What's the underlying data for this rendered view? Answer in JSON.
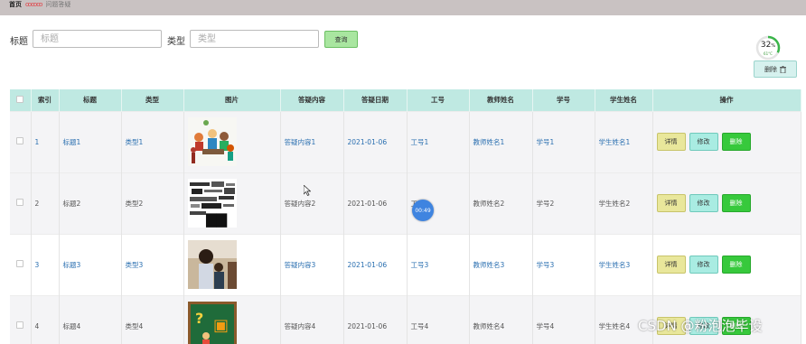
{
  "breadcrumb": {
    "home": "首页",
    "separator": "ꝏꝏꝏ",
    "current": "问题答疑"
  },
  "search": {
    "title_label": "标题",
    "title_placeholder": "标题",
    "type_label": "类型",
    "type_placeholder": "类型",
    "query_label": "查询"
  },
  "gauge": {
    "percent": "32",
    "unit": "%",
    "sub": "61°C",
    "fraction": 0.32
  },
  "batch_delete": {
    "label": "删除",
    "icon": "trash-icon"
  },
  "table": {
    "headers": [
      "索引",
      "标题",
      "类型",
      "图片",
      "答疑内容",
      "答疑日期",
      "工号",
      "教师姓名",
      "学号",
      "学生姓名",
      "操作"
    ],
    "rows": [
      {
        "index": "1",
        "title": "标题1",
        "type": "类型1",
        "content": "答疑内容1",
        "date": "2021-01-06",
        "staff_no": "工号1",
        "teacher": "教师姓名1",
        "student_no": "学号1",
        "student": "学生姓名1"
      },
      {
        "index": "2",
        "title": "标题2",
        "type": "类型2",
        "content": "答疑内容2",
        "date": "2021-01-06",
        "staff_no": "工号2",
        "teacher": "教师姓名2",
        "student_no": "学号2",
        "student": "学生姓名2"
      },
      {
        "index": "3",
        "title": "标题3",
        "type": "类型3",
        "content": "答疑内容3",
        "date": "2021-01-06",
        "staff_no": "工号3",
        "teacher": "教师姓名3",
        "student_no": "学号3",
        "student": "学生姓名3"
      },
      {
        "index": "4",
        "title": "标题4",
        "type": "类型4",
        "content": "答疑内容4",
        "date": "2021-01-06",
        "staff_no": "工号4",
        "teacher": "教师姓名4",
        "student_no": "学号4",
        "student": "学生姓名4"
      }
    ],
    "actions": {
      "detail": "详情",
      "edit": "修改",
      "delete": "删除"
    }
  },
  "overlay": {
    "timer": "00:49",
    "watermark": "CSDN @粉泡泡毕设"
  },
  "colors": {
    "header_bg": "#bfe9e2",
    "link": "#2a6fb0",
    "detail_btn": "#e9e79b",
    "edit_btn": "#a9ece2",
    "delete_btn": "#37c93c",
    "query_btn": "#a9e6a0"
  }
}
